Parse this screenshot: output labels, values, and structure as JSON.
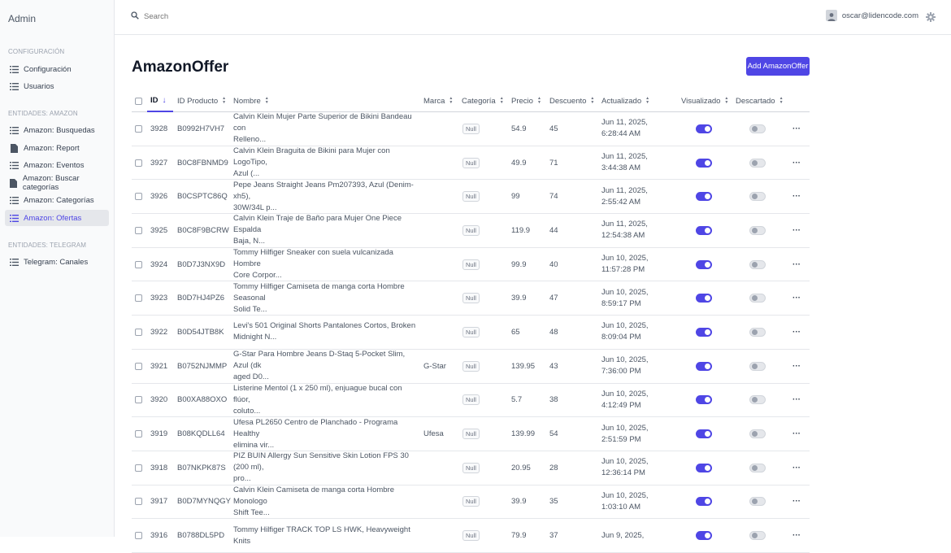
{
  "sidebar": {
    "brand": "Admin",
    "sections": [
      {
        "title": "CONFIGURACIÓN",
        "items": [
          {
            "label": "Configuración",
            "icon": "list-icon",
            "active": false
          },
          {
            "label": "Usuarios",
            "icon": "list-icon",
            "active": false
          }
        ]
      },
      {
        "title": "ENTIDADES: AMAZON",
        "items": [
          {
            "label": "Amazon: Busquedas",
            "icon": "list-icon",
            "active": false
          },
          {
            "label": "Amazon: Report",
            "icon": "document-icon",
            "active": false
          },
          {
            "label": "Amazon: Eventos",
            "icon": "list-icon",
            "active": false
          },
          {
            "label": "Amazon: Buscar categorías",
            "icon": "document-icon",
            "active": false
          },
          {
            "label": "Amazon: Categorías",
            "icon": "list-icon",
            "active": false
          },
          {
            "label": "Amazon: Ofertas",
            "icon": "list-icon",
            "active": true
          }
        ]
      },
      {
        "title": "ENTIDADES: TELEGRAM",
        "items": [
          {
            "label": "Telegram: Canales",
            "icon": "list-icon",
            "active": false
          }
        ]
      }
    ]
  },
  "topbar": {
    "search_placeholder": "Search",
    "user_email": "oscar@lidencode.com"
  },
  "main": {
    "title": "AmazonOffer",
    "add_button_label": "Add AmazonOffer"
  },
  "table": {
    "columns": [
      "ID",
      "ID Producto",
      "Nombre",
      "Marca",
      "Categoría",
      "Precio",
      "Descuento",
      "Actualizado",
      "Visualizado",
      "Descartado"
    ],
    "sorted_column": "ID",
    "rows": [
      {
        "id": "3928",
        "product_id": "B0992H7VH7",
        "name_line1": "Calvin Klein Mujer Parte Superior de Bikini Bandeau con",
        "name_line2": "Relleno...",
        "brand": "",
        "category": "Null",
        "price": "54.9",
        "discount": "45",
        "updated_line1": "Jun 11, 2025,",
        "updated_line2": "6:28:44 AM",
        "visualized": true,
        "discarded": false
      },
      {
        "id": "3927",
        "product_id": "B0C8FBNMD9",
        "name_line1": "Calvin Klein Braguita de Bikini para Mujer con LogoTipo,",
        "name_line2": "Azul (...",
        "brand": "",
        "category": "Null",
        "price": "49.9",
        "discount": "71",
        "updated_line1": "Jun 11, 2025,",
        "updated_line2": "3:44:38 AM",
        "visualized": true,
        "discarded": false
      },
      {
        "id": "3926",
        "product_id": "B0CSPTC86Q",
        "name_line1": "Pepe Jeans Straight Jeans Pm207393, Azul (Denim-xh5),",
        "name_line2": "30W/34L p...",
        "brand": "",
        "category": "Null",
        "price": "99",
        "discount": "74",
        "updated_line1": "Jun 11, 2025,",
        "updated_line2": "2:55:42 AM",
        "visualized": true,
        "discarded": false
      },
      {
        "id": "3925",
        "product_id": "B0C8F9BCRW",
        "name_line1": "Calvin Klein Traje de Baño para Mujer One Piece Espalda",
        "name_line2": "Baja, N...",
        "brand": "",
        "category": "Null",
        "price": "119.9",
        "discount": "44",
        "updated_line1": "Jun 11, 2025,",
        "updated_line2": "12:54:38 AM",
        "visualized": true,
        "discarded": false
      },
      {
        "id": "3924",
        "product_id": "B0D7J3NX9D",
        "name_line1": "Tommy Hilfiger Sneaker con suela vulcanizada Hombre",
        "name_line2": "Core Corpor...",
        "brand": "",
        "category": "Null",
        "price": "99.9",
        "discount": "40",
        "updated_line1": "Jun 10, 2025,",
        "updated_line2": "11:57:28 PM",
        "visualized": true,
        "discarded": false
      },
      {
        "id": "3923",
        "product_id": "B0D7HJ4PZ6",
        "name_line1": "Tommy Hilfiger Camiseta de manga corta Hombre Seasonal",
        "name_line2": "Solid Te...",
        "brand": "",
        "category": "Null",
        "price": "39.9",
        "discount": "47",
        "updated_line1": "Jun 10, 2025,",
        "updated_line2": "8:59:17 PM",
        "visualized": true,
        "discarded": false
      },
      {
        "id": "3922",
        "product_id": "B0D54JTB8K",
        "name_line1": "Levi's 501 Original Shorts Pantalones Cortos, Broken",
        "name_line2": "Midnight N...",
        "brand": "",
        "category": "Null",
        "price": "65",
        "discount": "48",
        "updated_line1": "Jun 10, 2025,",
        "updated_line2": "8:09:04 PM",
        "visualized": true,
        "discarded": false
      },
      {
        "id": "3921",
        "product_id": "B0752NJMMP",
        "name_line1": "G-Star Para Hombre Jeans D-Staq 5-Pocket Slim, Azul (dk",
        "name_line2": "aged D0...",
        "brand": "G-Star",
        "category": "Null",
        "price": "139.95",
        "discount": "43",
        "updated_line1": "Jun 10, 2025,",
        "updated_line2": "7:36:00 PM",
        "visualized": true,
        "discarded": false
      },
      {
        "id": "3920",
        "product_id": "B00XA88OXO",
        "name_line1": "Listerine Mentol (1 x 250 ml), enjuague bucal con flúor,",
        "name_line2": "coluto...",
        "brand": "",
        "category": "Null",
        "price": "5.7",
        "discount": "38",
        "updated_line1": "Jun 10, 2025,",
        "updated_line2": "4:12:49 PM",
        "visualized": true,
        "discarded": false
      },
      {
        "id": "3919",
        "product_id": "B08KQDLL64",
        "name_line1": "Ufesa PL2650 Centro de Planchado - Programa Healthy",
        "name_line2": "elimina vir...",
        "brand": "Ufesa",
        "category": "Null",
        "price": "139.99",
        "discount": "54",
        "updated_line1": "Jun 10, 2025,",
        "updated_line2": "2:51:59 PM",
        "visualized": true,
        "discarded": false
      },
      {
        "id": "3918",
        "product_id": "B07NKPK87S",
        "name_line1": "PIZ BUIN Allergy Sun Sensitive Skin Lotion FPS 30 (200 ml),",
        "name_line2": "pro...",
        "brand": "",
        "category": "Null",
        "price": "20.95",
        "discount": "28",
        "updated_line1": "Jun 10, 2025,",
        "updated_line2": "12:36:14 PM",
        "visualized": true,
        "discarded": false
      },
      {
        "id": "3917",
        "product_id": "B0D7MYNQGY",
        "name_line1": "Calvin Klein Camiseta de manga corta Hombre Monologo",
        "name_line2": "Shift Tee...",
        "brand": "",
        "category": "Null",
        "price": "39.9",
        "discount": "35",
        "updated_line1": "Jun 10, 2025,",
        "updated_line2": "1:03:10 AM",
        "visualized": true,
        "discarded": false
      },
      {
        "id": "3916",
        "product_id": "B0788DL5PD",
        "name_line1": "Tommy Hilfiger TRACK TOP LS HWK, Heavyweight Knits",
        "name_line2": "",
        "brand": "",
        "category": "Null",
        "price": "79.9",
        "discount": "37",
        "updated_line1": "Jun 9, 2025,",
        "updated_line2": "",
        "visualized": true,
        "discarded": false
      }
    ]
  },
  "colors": {
    "accent": "#4f46e5",
    "sidebar_bg": "#f9fafb",
    "active_item_bg": "#e5e7eb"
  }
}
